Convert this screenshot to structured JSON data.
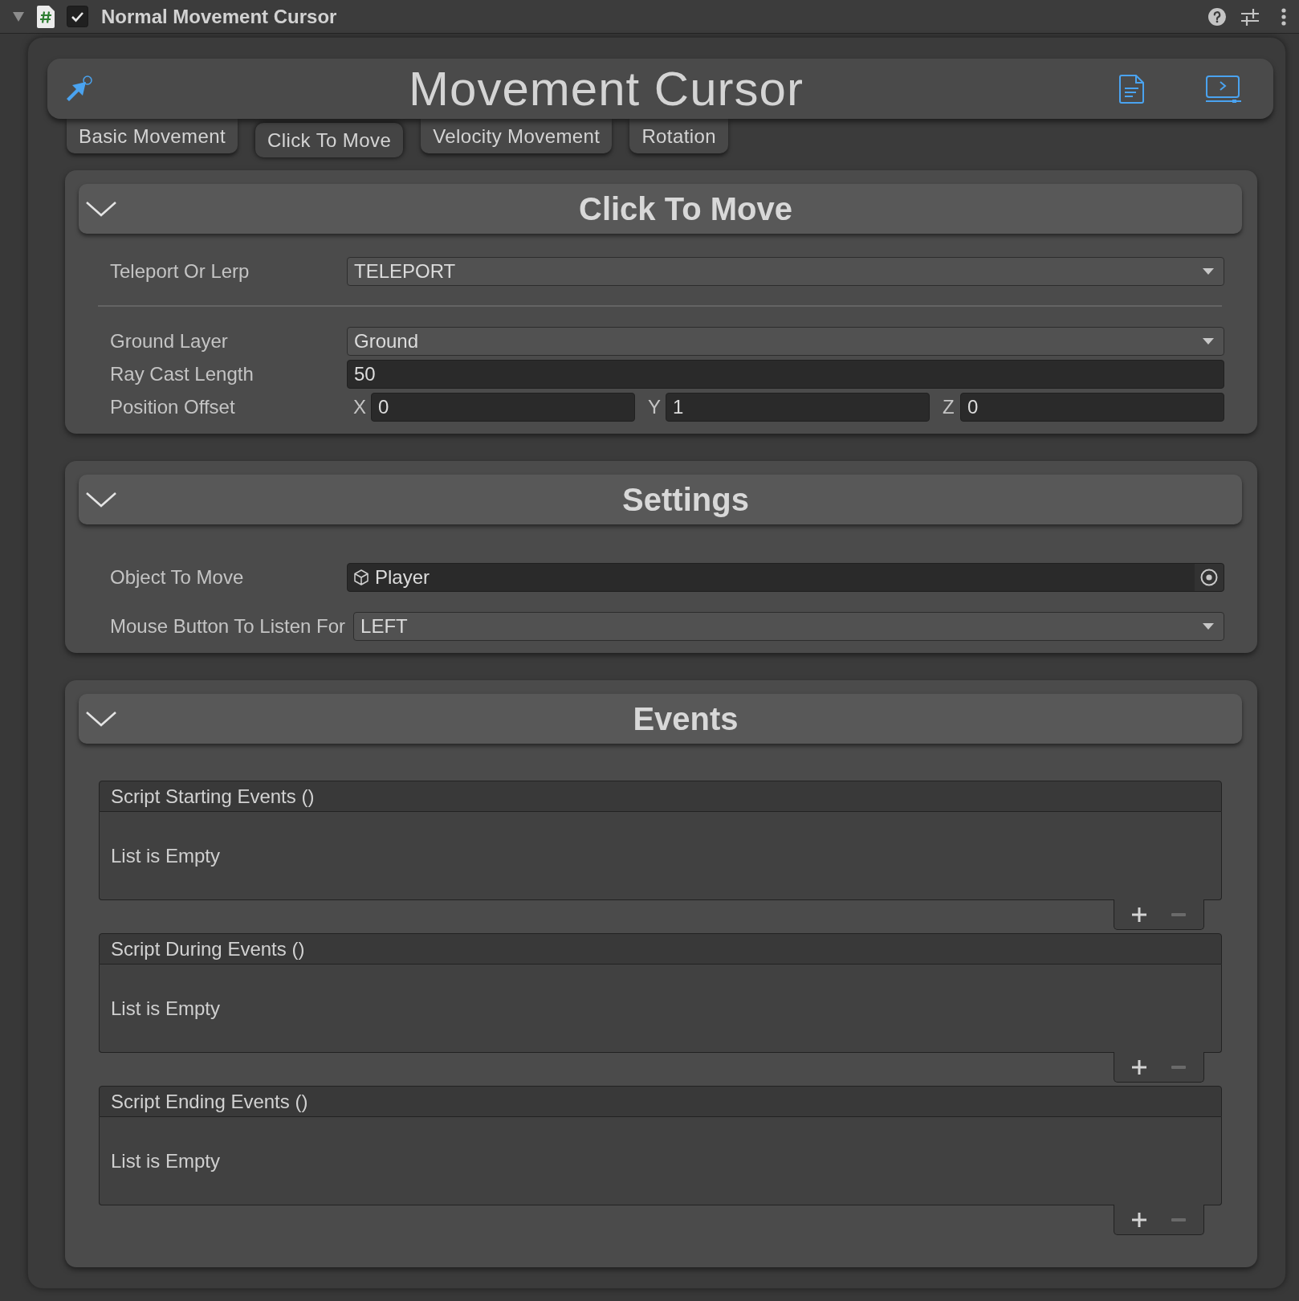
{
  "inspector_header": {
    "expanded": true,
    "enabled": true,
    "title": "Normal Movement Cursor"
  },
  "banner": {
    "title": "Movement Cursor"
  },
  "tabs": [
    {
      "label": "Basic Movement",
      "selected": false
    },
    {
      "label": "Click To Move",
      "selected": true
    },
    {
      "label": "Velocity Movement",
      "selected": false
    },
    {
      "label": "Rotation",
      "selected": false
    }
  ],
  "sections": [
    {
      "kind": "fields",
      "title": "Click To Move",
      "expanded": true,
      "rows": [
        {
          "kind": "dropdown",
          "label": "Teleport Or Lerp",
          "value": "TELEPORT"
        },
        {
          "kind": "divider"
        },
        {
          "kind": "dropdown",
          "label": "Ground Layer",
          "value": "Ground"
        },
        {
          "kind": "number",
          "label": "Ray Cast Length",
          "value": "50"
        },
        {
          "kind": "vector",
          "label": "Position Offset",
          "components": [
            {
              "axis": "X",
              "value": "0"
            },
            {
              "axis": "Y",
              "value": "1"
            },
            {
              "axis": "Z",
              "value": "0"
            }
          ]
        }
      ]
    },
    {
      "kind": "fields",
      "title": "Settings",
      "expanded": true,
      "rows": [
        {
          "kind": "object",
          "label": "Object To Move",
          "value": "Player"
        },
        {
          "kind": "dropdown",
          "label": "Mouse Button To Listen For",
          "value": "LEFT"
        }
      ]
    },
    {
      "kind": "events",
      "title": "Events",
      "expanded": true,
      "lists": [
        {
          "title": "Script Starting Events ()",
          "empty_text": "List is Empty",
          "remove_disabled": true
        },
        {
          "title": "Script During Events ()",
          "empty_text": "List is Empty",
          "remove_disabled": true
        },
        {
          "title": "Script Ending Events ()",
          "empty_text": "List is Empty",
          "remove_disabled": true
        }
      ]
    }
  ]
}
